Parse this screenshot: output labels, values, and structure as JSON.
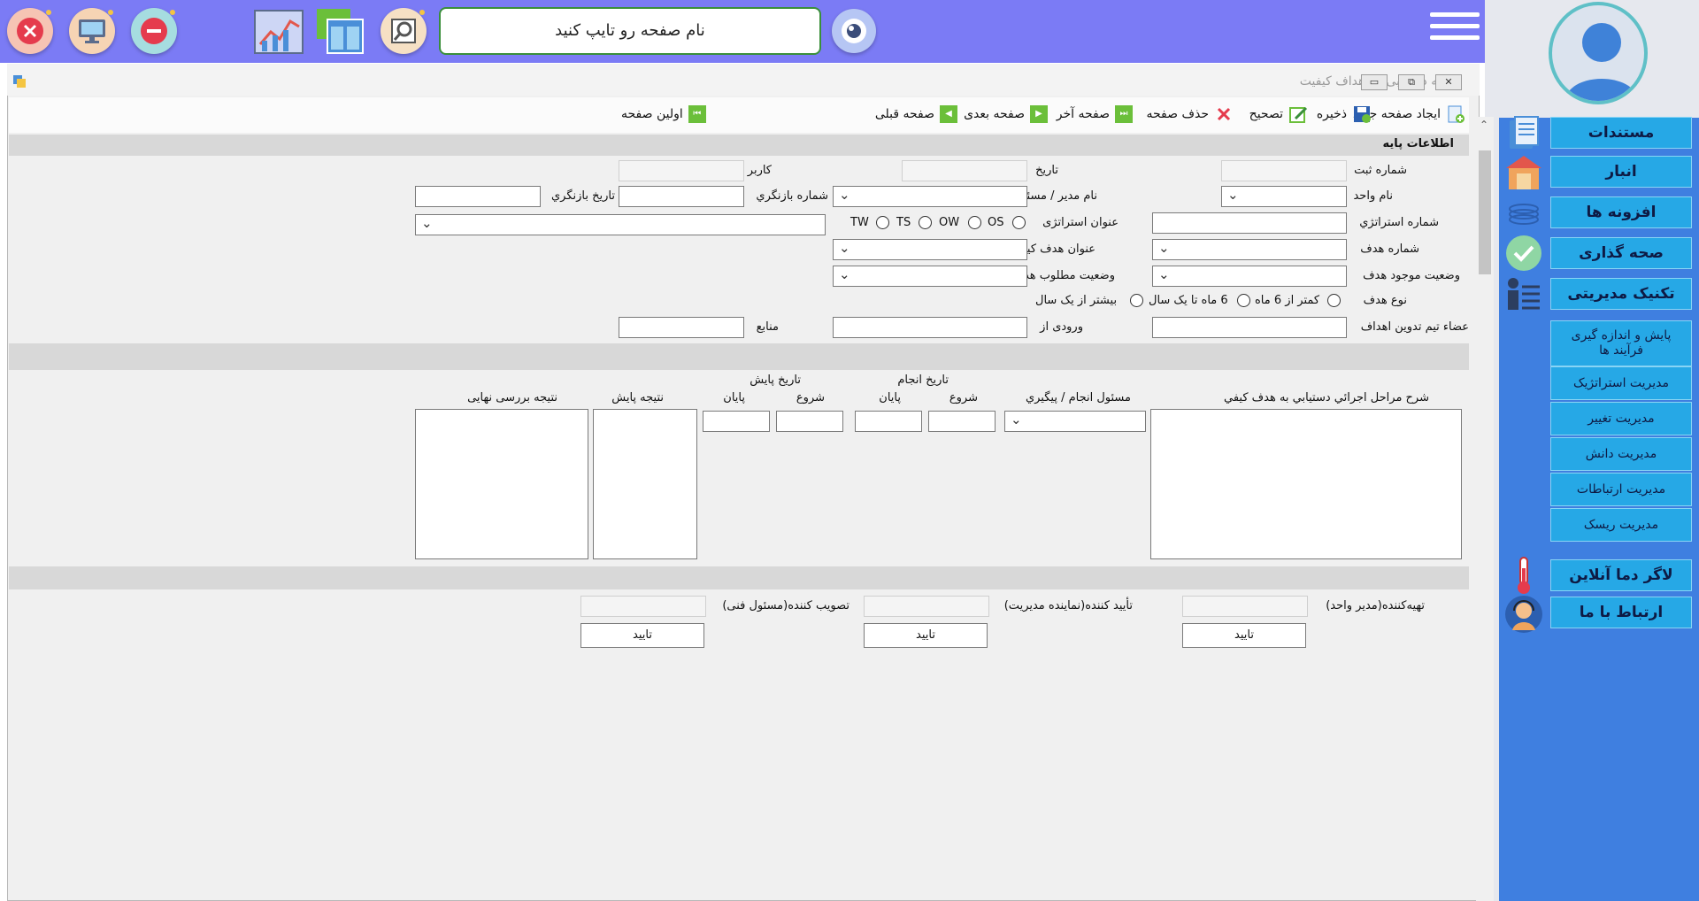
{
  "topbar": {
    "search_placeholder": "نام صفحه رو تایپ کنید"
  },
  "window": {
    "title": "برنامه دستیابی به اهداف کیفیت"
  },
  "toolbar": {
    "new_page": "ایجاد صفحه جدید",
    "save": "ذخیره",
    "edit": "تصحیح",
    "delete": "حذف صفحه",
    "last": "صفحه آخر",
    "next": "صفحه بعدی",
    "prev": "صفحه قبلی",
    "first": "اولین صفحه"
  },
  "sidebar": {
    "items": [
      {
        "label": "مستندات",
        "icon": "documents-icon"
      },
      {
        "label": "انبار",
        "icon": "warehouse-icon"
      },
      {
        "label": "افزونه ها",
        "icon": "plugins-icon"
      },
      {
        "label": "صحه گذاری",
        "icon": "check-icon"
      },
      {
        "label": "تکنیک مدیریتی",
        "icon": "manager-list-icon"
      }
    ],
    "sub_items": [
      "پایش و اندازه گیری فرآیند ها",
      "مدیریت استراتژیک",
      "مدیریت تغییر",
      "مدیریت دانش",
      "مدیریت ارتباطات",
      "مدیریت ریسک"
    ],
    "bottom": [
      {
        "label": "لاگر دما آنلاین",
        "icon": "thermometer-icon"
      },
      {
        "label": "ارتباط با ما",
        "icon": "support-agent-icon"
      }
    ]
  },
  "form": {
    "section_base": "اطلاعات پایه",
    "reg_no": "شماره ثبت",
    "date": "تاریخ",
    "user": "کاربر",
    "unit_name": "نام واحد",
    "manager": "نام مدیر / مسئول",
    "revision_no": "شماره بازنگري",
    "revision_date": "تاریخ بازنگري",
    "strategy_no": "شماره استراتژي",
    "strategy_title": "عنوان استراتژی",
    "radio_options": [
      "OS",
      "OW",
      "TS",
      "TW"
    ],
    "goal_no": "شماره هدف",
    "quality_goal_title": "عنوان هدف کیفي",
    "goal_current": "وضعیت موجود هدف",
    "goal_desired": "وضعیت مطلوب هدف",
    "goal_type": "نوع هدف",
    "goal_type_options": [
      "کمتر از 6 ماه",
      "6 ماه تا یک سال",
      "بیشتر از یک سال"
    ],
    "team_members": "عضاء تیم تدوین اهداف",
    "input_from": "ورودی از",
    "resources": "منابع"
  },
  "steps": {
    "description": "شرح مراحل اجرائي دستيابي به هدف کيفي",
    "responsible": "مسئول انجام / پیگیري",
    "do_date": "تاريخ انجام",
    "monitor_date": "تاریخ  پایش",
    "start": "شروع",
    "end": "پایان",
    "monitor_result": "نتیجه پایش",
    "final_result": "نتیجه بررسی نهایی"
  },
  "approval": {
    "prepared": "تهیه‌کننده(مدیر واحد)",
    "confirmed": "تأیید کننده(نماینده مدیریت)",
    "approved": "تصویب کننده(مسئول فنی)",
    "confirm_btn": "تایید"
  },
  "colors": {
    "topbar": "#7b7bf5",
    "sidebar_blue": "#3f7fe0",
    "nav_item": "#26a8e6",
    "toolbar_green": "#6bbf3a"
  }
}
